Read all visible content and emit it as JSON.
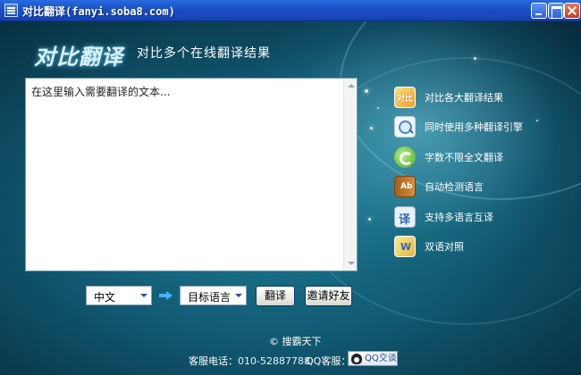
{
  "window": {
    "title": "对比翻译(fanyi.soba8.com)"
  },
  "header": {
    "logo": "对比翻译",
    "subtitle": "对比多个在线翻译结果"
  },
  "input": {
    "placeholder": "在这里输入需要翻译的文本..."
  },
  "features": [
    {
      "icon": "compare-icon",
      "label": "对比各大翻译结果"
    },
    {
      "icon": "search-icon",
      "label": "同时使用多种翻译引擎"
    },
    {
      "icon": "refresh-icon",
      "label": "字数不限全文翻译"
    },
    {
      "icon": "book-icon",
      "label": "自动检测语言"
    },
    {
      "icon": "translate-icon",
      "label": "支持多语言互译"
    },
    {
      "icon": "bilingual-icon",
      "label": "双语对照"
    }
  ],
  "controls": {
    "source_language": "中文",
    "target_language": "目标语言",
    "translate_button": "翻译",
    "invite_button": "邀请好友"
  },
  "footer": {
    "copyright": "© 搜霸天下",
    "phone_label": "客服电话：",
    "phone_number": "010-52887788",
    "qq_label": "QQ客服：",
    "qq_button": "QQ交谈"
  },
  "colors": {
    "titlebar": "#1a4fc4",
    "background": "#115a72",
    "accent": "#4ab0ff"
  }
}
